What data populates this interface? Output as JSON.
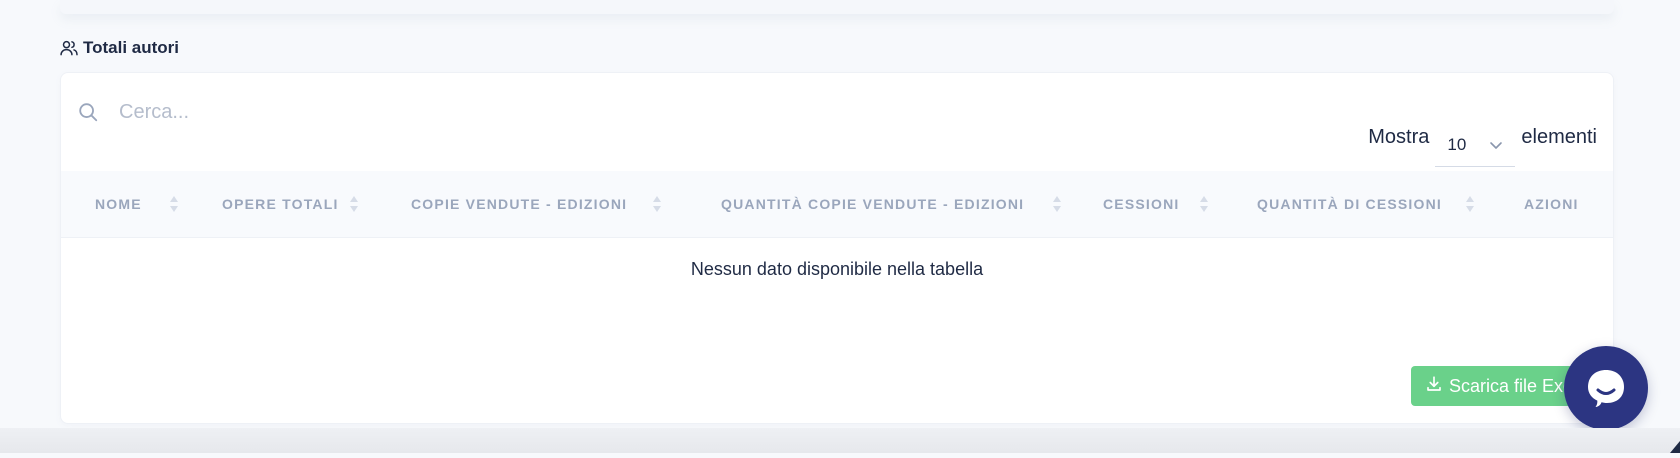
{
  "section": {
    "title": "Totali autori",
    "icon": "users-icon"
  },
  "search": {
    "placeholder": "Cerca...",
    "value": "",
    "icon": "search-icon"
  },
  "length": {
    "prefix": "Mostra",
    "selected": "10",
    "suffix": "elementi"
  },
  "table": {
    "columns": [
      "NOME",
      "OPERE TOTALI",
      "COPIE VENDUTE - EDIZIONI",
      "QUANTITÀ COPIE VENDUTE - EDIZIONI",
      "CESSIONI",
      "QUANTITÀ DI CESSIONI",
      "AZIONI"
    ],
    "empty_message": "Nessun dato disponibile nella tabella"
  },
  "export_button": {
    "label": "Scarica file Excel",
    "icon": "download-icon"
  },
  "chat_widget": {
    "icon": "chat-icon"
  },
  "colors": {
    "accent_green": "#6ad18a",
    "chat_navy": "#2c3582",
    "header_text": "#9aa6bc"
  }
}
